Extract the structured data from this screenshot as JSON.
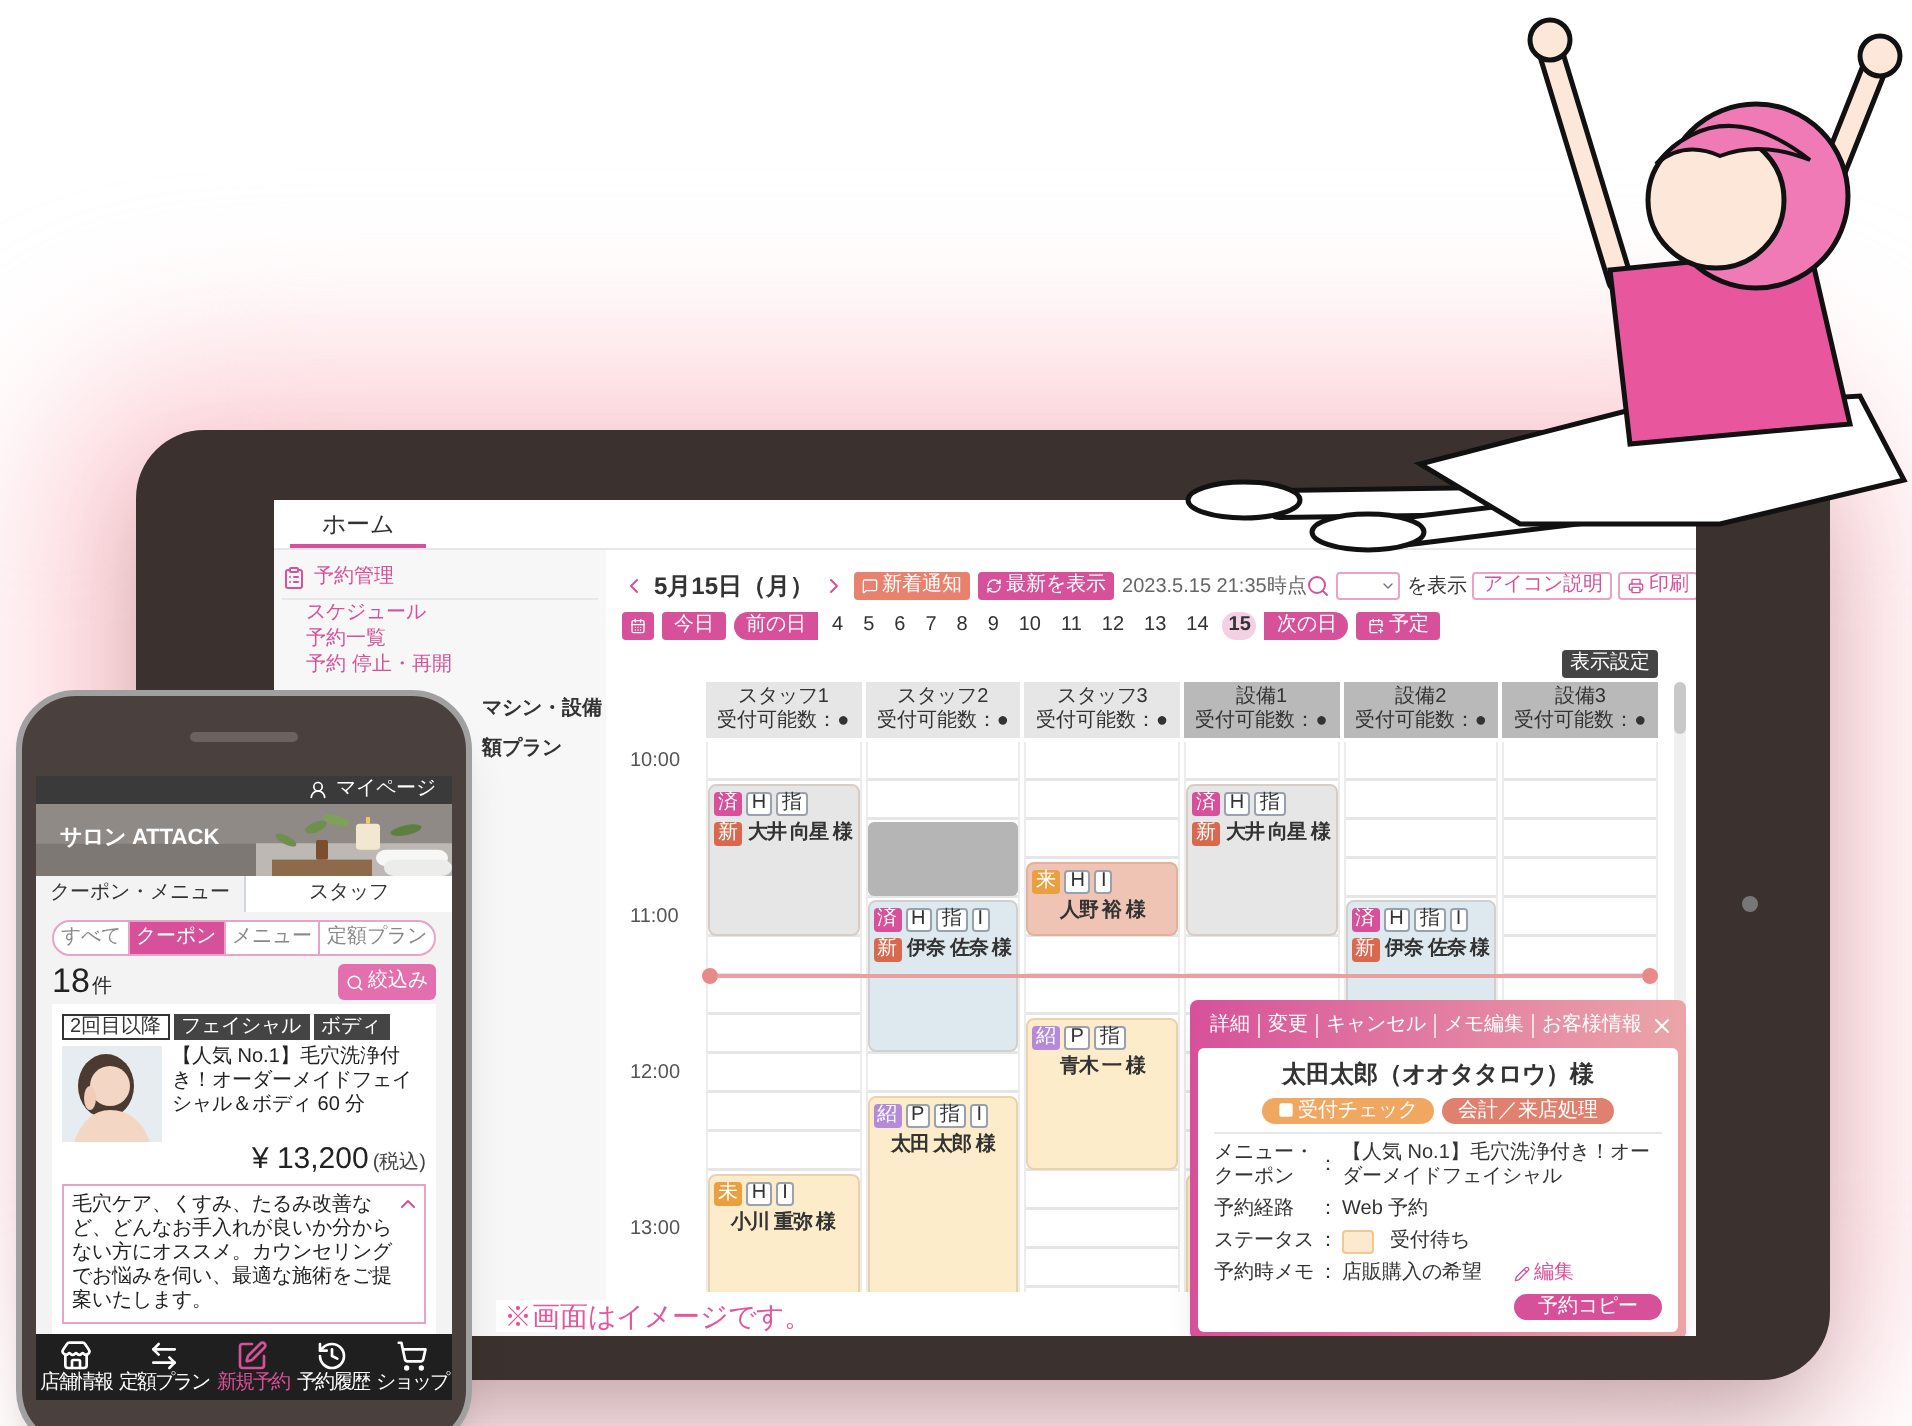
{
  "tablet": {
    "tabs": [
      {
        "label": "ホーム",
        "selected": true
      }
    ],
    "sidebar": {
      "section": "予約管理",
      "items": [
        "スケジュール",
        "予約一覧",
        "予約 停止・再開"
      ],
      "more_items": [
        "マシン・設備",
        "額プラン"
      ]
    },
    "toolbar": {
      "date": "5月15日（月）",
      "buttons": [
        {
          "label": "新着通知",
          "kind": "notice"
        },
        {
          "label": "最新を表示",
          "kind": "refresh"
        }
      ],
      "timestamp": "2023.5.15 21:35時点",
      "show_label": "を表示",
      "actions": [
        {
          "label": "アイコン説明",
          "kind": "plain"
        },
        {
          "label": "印刷",
          "kind": "print"
        }
      ]
    },
    "date_nav": {
      "today": "今日",
      "prev_day": "前の日",
      "dates": [
        {
          "label": "4",
          "selected": false
        },
        {
          "label": "5",
          "selected": false
        },
        {
          "label": "6",
          "selected": false
        },
        {
          "label": "7",
          "selected": false
        },
        {
          "label": "8",
          "selected": false
        },
        {
          "label": "9",
          "selected": false
        },
        {
          "label": "10",
          "selected": false
        },
        {
          "label": "11",
          "selected": false
        },
        {
          "label": "12",
          "selected": false
        },
        {
          "label": "13",
          "selected": false
        },
        {
          "label": "14",
          "selected": false
        },
        {
          "label": "15",
          "selected": true
        }
      ],
      "next_day": "次の日",
      "plan": "予定"
    },
    "display_settings": "表示設定",
    "times": [
      "10:00",
      "11:00",
      "12:00",
      "13:00"
    ],
    "columns": [
      {
        "title": "スタッフ1",
        "capacity": "受付可能数：●",
        "kind": "staff",
        "bookings": [
          {
            "kind": "booking",
            "color": "#e6e6e6",
            "tags": [
              {
                "label": "済",
                "kind": "status",
                "color": "#d6509a"
              },
              {
                "label": "H",
                "kind": "plain"
              },
              {
                "label": "指",
                "kind": "plain"
              }
            ],
            "badge": {
              "label": "新",
              "color": "#d9694e"
            },
            "name": "大井 向星 様"
          },
          {
            "kind": "booking",
            "color": "#fcecc9",
            "tags": [
              {
                "label": "未",
                "kind": "status",
                "color": "#e8a040"
              },
              {
                "label": "H",
                "kind": "plain"
              },
              {
                "label": "I",
                "kind": "plain"
              }
            ],
            "name": "小川 重弥 様"
          }
        ]
      },
      {
        "title": "スタッフ2",
        "capacity": "受付可能数：●",
        "kind": "staff",
        "bookings": [
          {
            "kind": "blocked"
          },
          {
            "kind": "booking",
            "color": "#dde9ef",
            "tags": [
              {
                "label": "済",
                "kind": "status",
                "color": "#d6509a"
              },
              {
                "label": "H",
                "kind": "plain"
              },
              {
                "label": "指",
                "kind": "plain"
              },
              {
                "label": "I",
                "kind": "plain"
              }
            ],
            "badge": {
              "label": "新",
              "color": "#d9694e"
            },
            "name": "伊奈 佐奈 様"
          },
          {
            "kind": "booking",
            "color": "#fcecc9",
            "tags": [
              {
                "label": "紹",
                "kind": "status",
                "color": "#b58bd9"
              },
              {
                "label": "P",
                "kind": "plain"
              },
              {
                "label": "指",
                "kind": "plain"
              },
              {
                "label": "I",
                "kind": "plain"
              }
            ],
            "name": "太田 太郎 様"
          }
        ]
      },
      {
        "title": "スタッフ3",
        "capacity": "受付可能数：●",
        "kind": "staff",
        "bookings": [
          {
            "kind": "booking",
            "color": "#f0c4b4",
            "tags": [
              {
                "label": "来",
                "kind": "status",
                "color": "#e8a040"
              },
              {
                "label": "H",
                "kind": "plain"
              },
              {
                "label": "I",
                "kind": "plain"
              }
            ],
            "name": "人野 裕 様"
          },
          {
            "kind": "booking",
            "color": "#fcecc9",
            "tags": [
              {
                "label": "紹",
                "kind": "status",
                "color": "#b58bd9"
              },
              {
                "label": "P",
                "kind": "plain"
              },
              {
                "label": "指",
                "kind": "plain"
              }
            ],
            "name": "青木 一 様"
          }
        ]
      },
      {
        "title": "設備1",
        "capacity": "受付可能数：●",
        "kind": "equipment",
        "bookings": [
          {
            "kind": "booking",
            "color": "#e6e6e6",
            "tags": [
              {
                "label": "済",
                "kind": "status",
                "color": "#d6509a"
              },
              {
                "label": "H",
                "kind": "plain"
              },
              {
                "label": "指",
                "kind": "plain"
              }
            ],
            "badge": {
              "label": "新",
              "color": "#d9694e"
            },
            "name": "大井 向星 様"
          },
          {
            "kind": "booking",
            "color": "#fcecc9"
          }
        ]
      },
      {
        "title": "設備2",
        "capacity": "受付可能数：●",
        "kind": "equipment",
        "bookings": [
          {
            "kind": "booking",
            "color": "#dde9ef",
            "tags": [
              {
                "label": "済",
                "kind": "status",
                "color": "#d6509a"
              },
              {
                "label": "H",
                "kind": "plain"
              },
              {
                "label": "指",
                "kind": "plain"
              },
              {
                "label": "I",
                "kind": "plain"
              }
            ],
            "badge": {
              "label": "新",
              "color": "#d9694e"
            },
            "name": "伊奈 佐奈 様"
          }
        ]
      },
      {
        "title": "設備3",
        "capacity": "受付可能数：●",
        "kind": "equipment"
      }
    ],
    "popup": {
      "tabs": [
        "詳細",
        "変更",
        "キャンセル",
        "メモ編集",
        "お客様情報"
      ],
      "customer": "太田太郎（オオタタロウ）様",
      "actions": [
        {
          "label": "受付チェック",
          "kind": "check"
        },
        {
          "label": "会計／来店処理",
          "kind": "checkout"
        }
      ],
      "fields": [
        {
          "label": "メニュー・クーポン",
          "sep": "：",
          "value": "【人気 No.1】毛穴洗浄付き！オーダーメイドフェイシャル",
          "kind": "text"
        },
        {
          "label": "予約経路",
          "sep": "：",
          "value": "Web 予約",
          "kind": "text"
        },
        {
          "label": "ステータス",
          "sep": "：",
          "value": "受付待ち",
          "kind": "status",
          "color": "#fde9cf"
        },
        {
          "label": "予約時メモ",
          "sep": "：",
          "value": "店販購入の希望",
          "kind": "memo",
          "action": "編集"
        }
      ],
      "copy_button": "予約コピー"
    },
    "note": "※画面はイメージです。"
  },
  "phone": {
    "mypage": "マイページ",
    "salon": "サロン ATTACK",
    "tabs": [
      {
        "label": "クーポン・メニュー",
        "selected": true
      },
      {
        "label": "スタッフ",
        "selected": false
      }
    ],
    "filters": [
      {
        "label": "すべて",
        "selected": false
      },
      {
        "label": "クーポン",
        "selected": true
      },
      {
        "label": "メニュー",
        "selected": false
      },
      {
        "label": "定額プラン",
        "selected": false
      }
    ],
    "count": "18",
    "count_unit": "件",
    "filter_button": "絞込み",
    "coupon": {
      "tags": [
        {
          "label": "2回目以降",
          "kind": "outline"
        },
        {
          "label": "フェイシャル",
          "kind": "solid"
        },
        {
          "label": "ボディ",
          "kind": "solid"
        }
      ],
      "title": "【人気 No.1】毛穴洗浄付き！オーダーメイドフェイシャル＆ボディ 60 分",
      "price": "¥ 13,200",
      "tax": "(税込)",
      "description": "毛穴ケア、くすみ、たるみ改善など、どんなお手入れが良いか分からない方にオススメ。カウンセリングでお悩みを伺い、最適な施術をご提案いたします。",
      "expanded": true
    },
    "nav": [
      {
        "label": "店舗情報",
        "kind": "store",
        "selected": false
      },
      {
        "label": "定額プラン",
        "kind": "swap",
        "selected": false
      },
      {
        "label": "新規予約",
        "kind": "edit",
        "selected": true
      },
      {
        "label": "予約履歴",
        "kind": "history",
        "selected": false
      },
      {
        "label": "ショップ",
        "kind": "cart",
        "selected": false
      }
    ]
  }
}
